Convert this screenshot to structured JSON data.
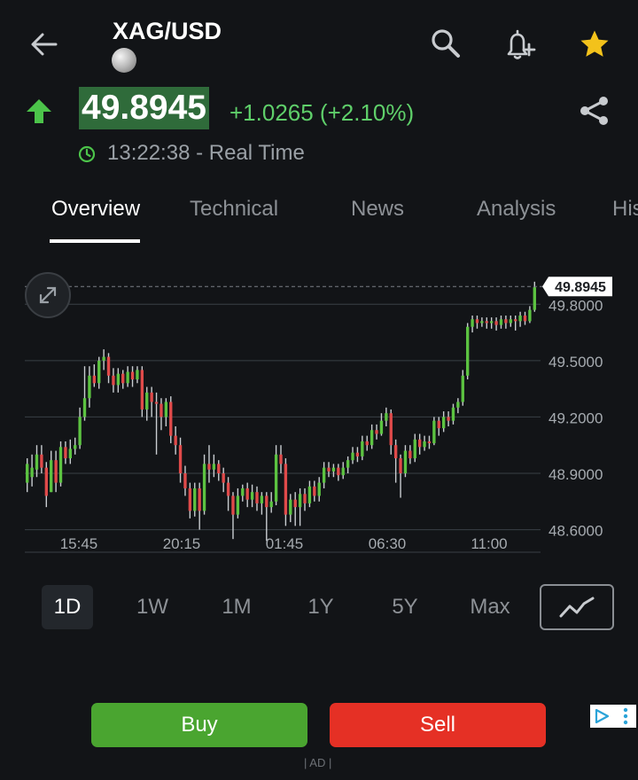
{
  "header": {
    "symbol": "XAG/USD",
    "icons": [
      "back-arrow-icon",
      "search-icon",
      "add-alert-icon",
      "star-icon"
    ]
  },
  "quote": {
    "price": "49.8945",
    "change": "+1.0265 (+2.10%)",
    "time": "13:22:38 - Real Time",
    "direction": "up"
  },
  "tabs": [
    {
      "label": "Overview",
      "active": true
    },
    {
      "label": "Technical",
      "active": false
    },
    {
      "label": "News",
      "active": false
    },
    {
      "label": "Analysis",
      "active": false
    },
    {
      "label": "His",
      "active": false
    }
  ],
  "ranges": [
    {
      "label": "1D",
      "selected": true
    },
    {
      "label": "1W",
      "selected": false
    },
    {
      "label": "1M",
      "selected": false
    },
    {
      "label": "1Y",
      "selected": false
    },
    {
      "label": "5Y",
      "selected": false
    },
    {
      "label": "Max",
      "selected": false
    }
  ],
  "actions": {
    "buy": "Buy",
    "sell": "Sell"
  },
  "ad_label": "| AD |",
  "colors": {
    "background": "#121417",
    "up": "#5fcf6a",
    "candle_up": "#5cc341",
    "candle_down": "#e04a4a",
    "buy": "#4aa530",
    "sell": "#e53025"
  },
  "chart_data": {
    "type": "candlestick",
    "x_ticks": [
      "15:45",
      "20:15",
      "01:45",
      "06:30",
      "11:00"
    ],
    "y_ticks": [
      "48.6000",
      "48.9000",
      "49.2000",
      "49.5000",
      "49.8000"
    ],
    "ylim": [
      48.48,
      49.99
    ],
    "last_price_label": "49.8945",
    "candles": [
      [
        48.85,
        48.95,
        48.98,
        48.8
      ],
      [
        48.88,
        48.93,
        49.0,
        48.83
      ],
      [
        48.92,
        49.0,
        49.05,
        48.88
      ],
      [
        49.0,
        48.93,
        49.05,
        48.9
      ],
      [
        48.93,
        48.78,
        48.96,
        48.72
      ],
      [
        48.8,
        48.97,
        49.02,
        48.8
      ],
      [
        48.97,
        48.85,
        49.02,
        48.8
      ],
      [
        48.85,
        49.04,
        49.07,
        48.83
      ],
      [
        49.04,
        48.98,
        49.07,
        48.95
      ],
      [
        48.98,
        49.03,
        49.08,
        48.95
      ],
      [
        49.03,
        49.05,
        49.09,
        49.0
      ],
      [
        49.05,
        49.2,
        49.25,
        49.03
      ],
      [
        49.2,
        49.3,
        49.47,
        49.18
      ],
      [
        49.3,
        49.42,
        49.47,
        49.25
      ],
      [
        49.42,
        49.38,
        49.48,
        49.36
      ],
      [
        49.38,
        49.5,
        49.52,
        49.35
      ],
      [
        49.5,
        49.52,
        49.56,
        49.45
      ],
      [
        49.52,
        49.42,
        49.54,
        49.38
      ],
      [
        49.42,
        49.37,
        49.46,
        49.33
      ],
      [
        49.37,
        49.43,
        49.46,
        49.33
      ],
      [
        49.43,
        49.38,
        49.45,
        49.35
      ],
      [
        49.38,
        49.44,
        49.47,
        49.36
      ],
      [
        49.44,
        49.4,
        49.47,
        49.36
      ],
      [
        49.4,
        49.45,
        49.47,
        49.38
      ],
      [
        49.45,
        49.24,
        49.47,
        49.2
      ],
      [
        49.24,
        49.33,
        49.36,
        49.18
      ],
      [
        49.33,
        49.28,
        49.36,
        49.2
      ],
      [
        49.28,
        49.27,
        49.33,
        49.0
      ],
      [
        49.27,
        49.2,
        49.3,
        49.13
      ],
      [
        49.2,
        49.28,
        49.3,
        49.15
      ],
      [
        49.28,
        49.1,
        49.31,
        49.06
      ],
      [
        49.1,
        49.05,
        49.15,
        49.0
      ],
      [
        49.05,
        48.9,
        49.09,
        48.85
      ],
      [
        48.9,
        48.82,
        48.94,
        48.78
      ],
      [
        48.82,
        48.7,
        48.85,
        48.66
      ],
      [
        48.7,
        48.82,
        48.85,
        48.67
      ],
      [
        48.82,
        48.7,
        48.85,
        48.6
      ],
      [
        48.7,
        48.95,
        49.0,
        48.68
      ],
      [
        48.95,
        48.92,
        49.05,
        48.85
      ],
      [
        48.92,
        48.95,
        49.0,
        48.88
      ],
      [
        48.95,
        48.9,
        48.97,
        48.86
      ],
      [
        48.9,
        48.85,
        48.93,
        48.8
      ],
      [
        48.85,
        48.78,
        48.88,
        48.7
      ],
      [
        48.78,
        48.68,
        48.8,
        48.55
      ],
      [
        48.68,
        48.78,
        48.82,
        48.66
      ],
      [
        48.78,
        48.82,
        48.84,
        48.75
      ],
      [
        48.82,
        48.76,
        48.85,
        48.72
      ],
      [
        48.76,
        48.8,
        48.84,
        48.72
      ],
      [
        48.8,
        48.74,
        48.83,
        48.7
      ],
      [
        48.74,
        48.78,
        48.8,
        48.68
      ],
      [
        48.78,
        48.72,
        48.8,
        48.54
      ],
      [
        48.72,
        48.75,
        48.8,
        48.69
      ],
      [
        48.75,
        49.0,
        49.05,
        48.73
      ],
      [
        49.0,
        48.95,
        49.05,
        48.9
      ],
      [
        48.95,
        48.68,
        48.98,
        48.62
      ],
      [
        48.68,
        48.76,
        48.79,
        48.64
      ],
      [
        48.76,
        48.72,
        48.8,
        48.62
      ],
      [
        48.72,
        48.79,
        48.82,
        48.62
      ],
      [
        48.79,
        48.74,
        48.82,
        48.7
      ],
      [
        48.74,
        48.83,
        48.86,
        48.72
      ],
      [
        48.83,
        48.78,
        48.86,
        48.75
      ],
      [
        48.78,
        48.85,
        48.88,
        48.75
      ],
      [
        48.85,
        48.93,
        48.96,
        48.82
      ],
      [
        48.93,
        48.91,
        48.96,
        48.88
      ],
      [
        48.91,
        48.93,
        48.95,
        48.88
      ],
      [
        48.93,
        48.89,
        48.95,
        48.86
      ],
      [
        48.89,
        48.93,
        48.96,
        48.87
      ],
      [
        48.93,
        48.97,
        48.99,
        48.9
      ],
      [
        48.97,
        49.01,
        49.04,
        48.95
      ],
      [
        49.01,
        48.99,
        49.04,
        48.96
      ],
      [
        48.99,
        49.07,
        49.1,
        48.97
      ],
      [
        49.07,
        49.05,
        49.1,
        49.02
      ],
      [
        49.05,
        49.13,
        49.16,
        49.03
      ],
      [
        49.13,
        49.11,
        49.16,
        49.08
      ],
      [
        49.11,
        49.18,
        49.22,
        49.1
      ],
      [
        49.18,
        49.22,
        49.25,
        49.15
      ],
      [
        49.22,
        49.05,
        49.24,
        49.0
      ],
      [
        49.05,
        48.98,
        49.08,
        48.85
      ],
      [
        48.98,
        48.9,
        49.0,
        48.77
      ],
      [
        48.9,
        49.02,
        49.05,
        48.88
      ],
      [
        49.02,
        48.98,
        49.05,
        48.95
      ],
      [
        48.98,
        49.08,
        49.11,
        48.96
      ],
      [
        49.08,
        49.04,
        49.11,
        49.0
      ],
      [
        49.04,
        49.07,
        49.1,
        49.02
      ],
      [
        49.07,
        49.06,
        49.1,
        49.03
      ],
      [
        49.06,
        49.18,
        49.2,
        49.05
      ],
      [
        49.18,
        49.14,
        49.2,
        49.1
      ],
      [
        49.14,
        49.2,
        49.23,
        49.12
      ],
      [
        49.2,
        49.18,
        49.23,
        49.15
      ],
      [
        49.18,
        49.25,
        49.27,
        49.16
      ],
      [
        49.25,
        49.28,
        49.3,
        49.22
      ],
      [
        49.28,
        49.42,
        49.45,
        49.26
      ],
      [
        49.42,
        49.68,
        49.7,
        49.4
      ],
      [
        49.68,
        49.72,
        49.74,
        49.65
      ],
      [
        49.72,
        49.7,
        49.74,
        49.67
      ],
      [
        49.7,
        49.71,
        49.73,
        49.68
      ],
      [
        49.71,
        49.7,
        49.73,
        49.67
      ],
      [
        49.7,
        49.71,
        49.73,
        49.67
      ],
      [
        49.71,
        49.69,
        49.73,
        49.66
      ],
      [
        49.69,
        49.72,
        49.74,
        49.67
      ],
      [
        49.72,
        49.7,
        49.74,
        49.67
      ],
      [
        49.7,
        49.72,
        49.74,
        49.68
      ],
      [
        49.72,
        49.71,
        49.74,
        49.66
      ],
      [
        49.71,
        49.74,
        49.76,
        49.68
      ],
      [
        49.74,
        49.71,
        49.76,
        49.69
      ],
      [
        49.71,
        49.77,
        49.79,
        49.7
      ],
      [
        49.77,
        49.89,
        49.92,
        49.76
      ]
    ]
  }
}
